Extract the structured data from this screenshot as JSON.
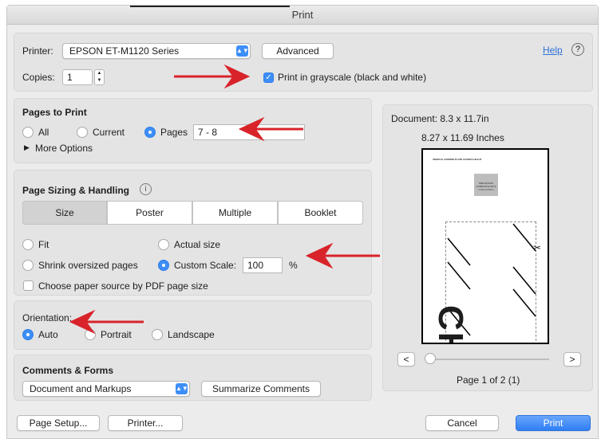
{
  "window": {
    "title": "Print"
  },
  "printer": {
    "label": "Printer:",
    "selected": "EPSON ET-M1120 Series",
    "advanced_label": "Advanced",
    "help_label": "Help",
    "help_icon": "?"
  },
  "copies": {
    "label": "Copies:",
    "value": "1",
    "grayscale_label": "Print in grayscale (black and white)",
    "grayscale_checked": true
  },
  "pages_to_print": {
    "title": "Pages to Print",
    "options": [
      "All",
      "Current",
      "Pages"
    ],
    "selected": "Pages",
    "range_value": "7 - 8",
    "more_options_label": "More Options"
  },
  "sizing": {
    "title": "Page Sizing & Handling",
    "info_icon": "i",
    "tabs": [
      "Size",
      "Poster",
      "Multiple",
      "Booklet"
    ],
    "active_tab": "Size",
    "fit_label": "Fit",
    "actual_size_label": "Actual size",
    "shrink_label": "Shrink oversized pages",
    "custom_scale_label": "Custom Scale:",
    "scale_value": "100",
    "scale_unit": "%",
    "paper_source_label": "Choose paper source by PDF page size",
    "selected": "Custom Scale"
  },
  "orientation": {
    "title": "Orientation:",
    "options": [
      "Auto",
      "Portrait",
      "Landscape"
    ],
    "selected": "Auto"
  },
  "comments": {
    "title": "Comments & Forms",
    "selected": "Document and Markups",
    "summarize_label": "Summarize Comments"
  },
  "preview": {
    "document_size": "Document: 8.3 x 11.7in",
    "page_size": "8.27 x 11.69 Inches",
    "page_heading": "VEHICLE LICENSE PLATE COVER A•B•C•D",
    "page_grey_box_text": "PRE-DOCKS\nCOMPLETE KEYS\n± 0mm 0.5mm",
    "page_big_text": "CHIC",
    "prev_label": "<",
    "next_label": ">",
    "page_counter": "Page 1 of 2 (1)",
    "slider_position": 0.0
  },
  "footer": {
    "page_setup_label": "Page Setup...",
    "printer_label": "Printer...",
    "cancel_label": "Cancel",
    "print_label": "Print"
  },
  "colors": {
    "accent": "#3d8ef7",
    "annotation_arrow": "#d9232a"
  }
}
